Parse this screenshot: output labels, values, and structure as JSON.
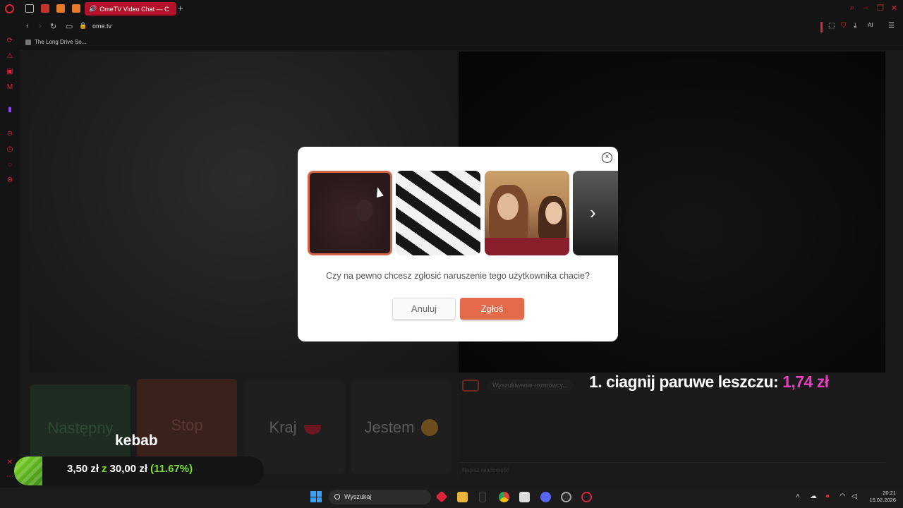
{
  "browser": {
    "active_tab_title": "OmeTV Video Chat — C",
    "url": "ome.tv",
    "bookmark": "The Long Drive So...",
    "new_tab": "+",
    "ai_label": "AI"
  },
  "page": {
    "controls": {
      "next_label": "Następny",
      "stop_label": "Stop",
      "country_label": "Kraj",
      "gender_label": "Jestem"
    },
    "chat": {
      "status": "Wyszukiwanie rozmówcy...",
      "input_placeholder": "Napisz wiadomość"
    }
  },
  "modal": {
    "question": "Czy na pewno chcesz zgłosić naruszenie tego użytkownika chacie?",
    "cancel_label": "Anuluj",
    "report_label": "Zgłoś",
    "close_icon": "×",
    "next_arrow": "›"
  },
  "overlay": {
    "ticker_label": "1. ciagnij paruwe leszczu:",
    "ticker_amount": "1,74 zł",
    "goal_title": "kebab",
    "goal_current": "3,50 zł",
    "goal_sep": "z",
    "goal_target": "30,00 zł",
    "goal_percent": "(11.67%)",
    "goal_progress": 0.1167
  },
  "taskbar": {
    "search_placeholder": "Wyszukaj",
    "time": "20:21",
    "date": "15.02.2026"
  },
  "colors": {
    "opera_red": "#e0233c",
    "report_button": "#e36a4a",
    "ticker_amount": "#e83ec1",
    "goal_green": "#7be02c"
  }
}
